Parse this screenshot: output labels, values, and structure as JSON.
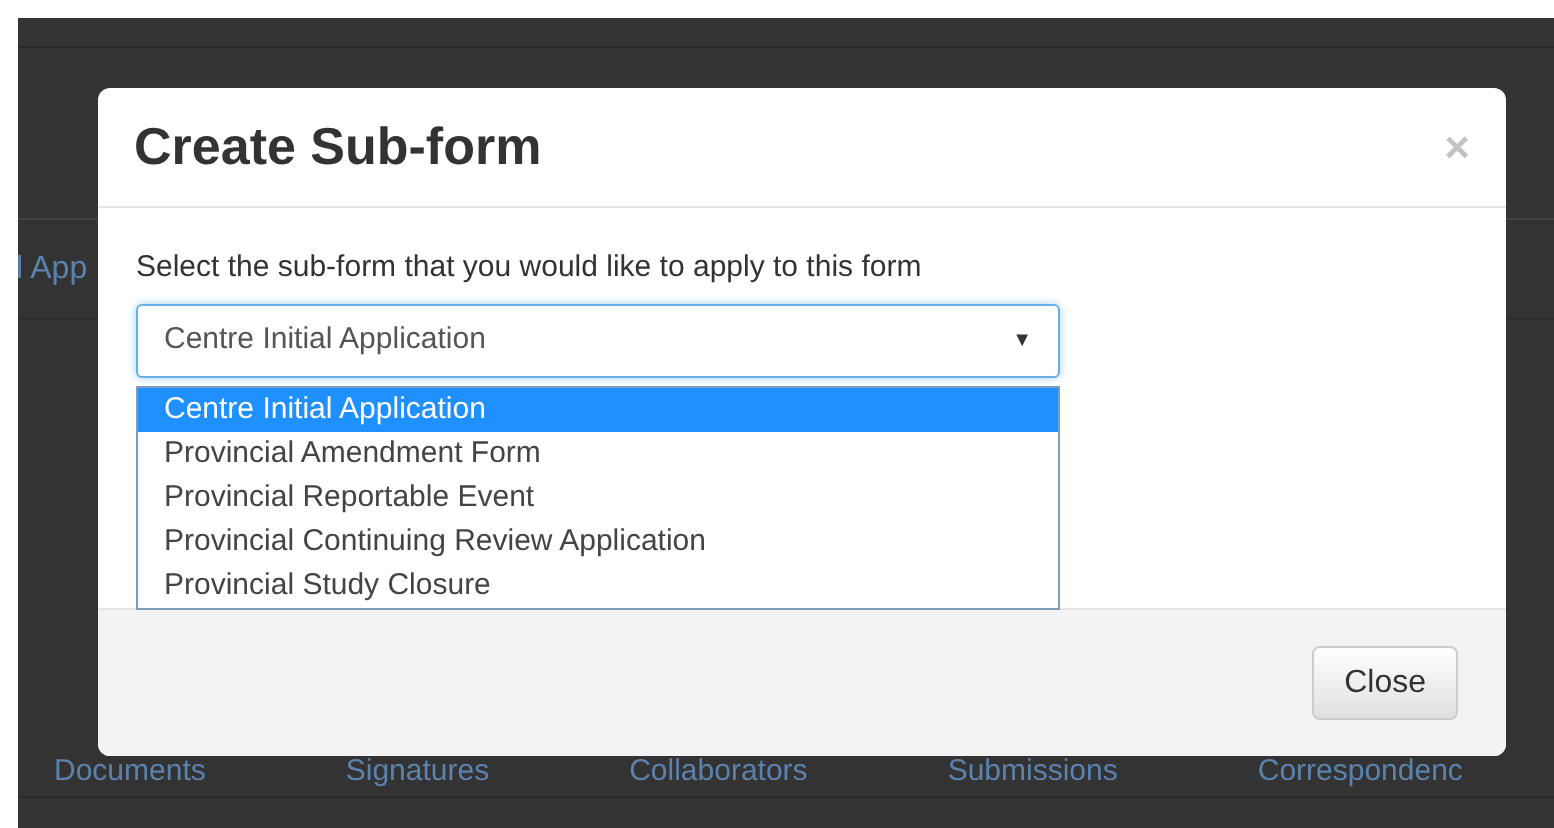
{
  "background": {
    "partial_label": "l App",
    "tabs": [
      "Documents",
      "Signatures",
      "Collaborators",
      "Submissions",
      "Correspondenc"
    ]
  },
  "modal": {
    "title": "Create Sub-form",
    "close_icon": "×",
    "prompt": "Select the sub-form that you would like to apply to this form",
    "select": {
      "value": "Centre Initial Application",
      "expanded": true,
      "caret": "▼",
      "options": [
        {
          "label": "Centre Initial Application",
          "selected": true
        },
        {
          "label": "Provincial Amendment Form",
          "selected": false
        },
        {
          "label": "Provincial Reportable Event",
          "selected": false
        },
        {
          "label": "Provincial Continuing Review Application",
          "selected": false
        },
        {
          "label": "Provincial Study Closure",
          "selected": false
        }
      ]
    },
    "footer_button": "Close"
  }
}
